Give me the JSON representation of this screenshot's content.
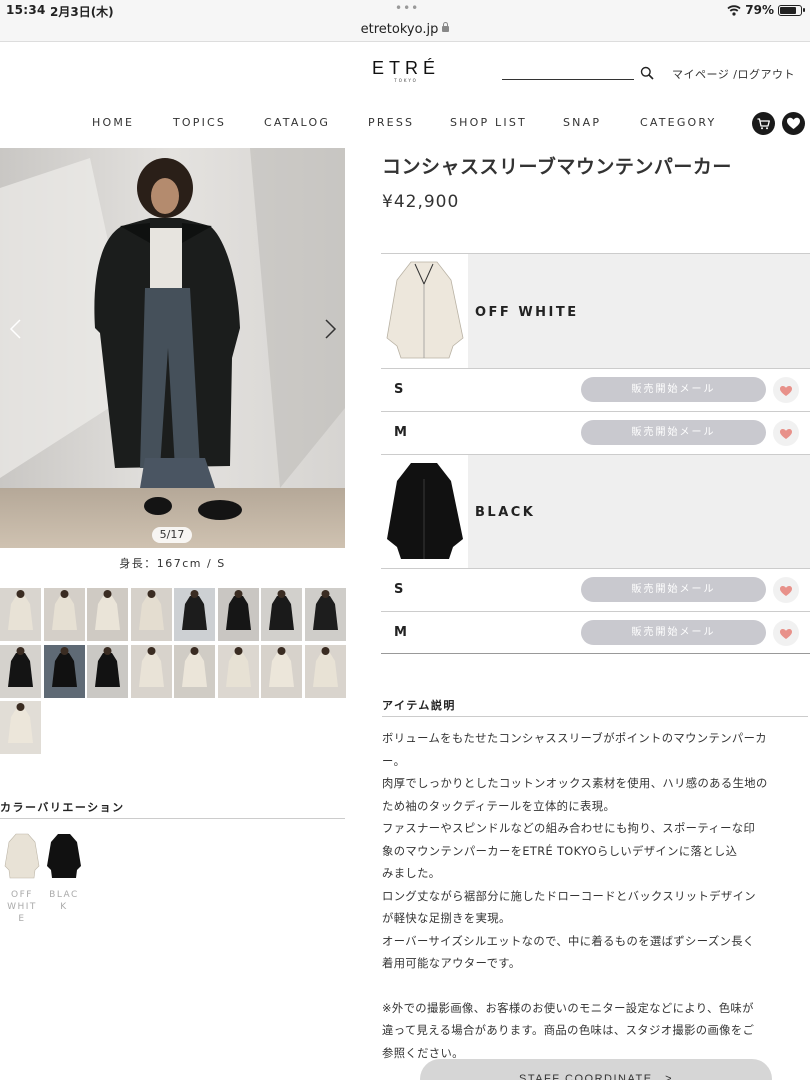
{
  "status_bar": {
    "time": "15:34",
    "date": "2月3日(木)",
    "battery": "79%",
    "battery_level": 0.79
  },
  "browser": {
    "url": "etretokyo.jp",
    "tab_dots": "•••"
  },
  "header": {
    "logo": "ETRÉ",
    "logo_sub": "TOKYO",
    "search_placeholder": "",
    "account_link": "マイページ /ログアウト"
  },
  "nav": {
    "items": [
      "HOME",
      "TOPICS",
      "CATALOG",
      "PRESS",
      "SHOP LIST",
      "SNAP",
      "CATEGORY"
    ]
  },
  "gallery": {
    "counter": "5/17",
    "model_info": "身長：167cm / S",
    "thumbnail_count": 17
  },
  "color_variation": {
    "title": "カラーバリエーション",
    "items": [
      {
        "label": "OFF WHITE",
        "color": "#e8e2d6"
      },
      {
        "label": "BLACK",
        "color": "#111111"
      }
    ]
  },
  "product": {
    "title": "コンシャススリーブマウンテンパーカー",
    "price": "¥42,900",
    "variants": [
      {
        "color": "OFF WHITE",
        "swatch": "#e8e2d6",
        "sizes": [
          {
            "size": "S",
            "button": "販売開始メール"
          },
          {
            "size": "M",
            "button": "販売開始メール"
          }
        ]
      },
      {
        "color": "BLACK",
        "swatch": "#111111",
        "sizes": [
          {
            "size": "S",
            "button": "販売開始メール"
          },
          {
            "size": "M",
            "button": "販売開始メール"
          }
        ]
      }
    ],
    "description_title": "アイテム説明",
    "description_lines": [
      "ボリュームをもたせたコンシャススリーブがポイントのマウンテンパーカ",
      "ー。",
      "肉厚でしっかりとしたコットンオックス素材を使用、ハリ感のある生地の",
      "ため袖のタックディテールを立体的に表現。",
      "ファスナーやスピンドルなどの組み合わせにも拘り、スポーティーな印",
      "象のマウンテンパーカーをETRÉ TOKYOらしいデザインに落とし込",
      "みました。",
      "ロング丈ながら裾部分に施したドローコードとバックスリットデザイン",
      "が軽快な足捌きを実現。",
      "オーバーサイズシルエットなので、中に着るものを選ばずシーズン長く",
      "着用可能なアウターです。"
    ],
    "note_lines": [
      "※外での撮影画像、お客様のお使いのモニター設定などにより、色味が",
      "違って見える場合があります。商品の色味は、スタジオ撮影の画像をご",
      "参照ください。"
    ],
    "staff_coordinate": "STAFF COORDINATE　>"
  },
  "colors": {
    "accent_heart": "#e8918a",
    "button_gray": "#c9c9cf",
    "dark": "#1a1a1a"
  }
}
